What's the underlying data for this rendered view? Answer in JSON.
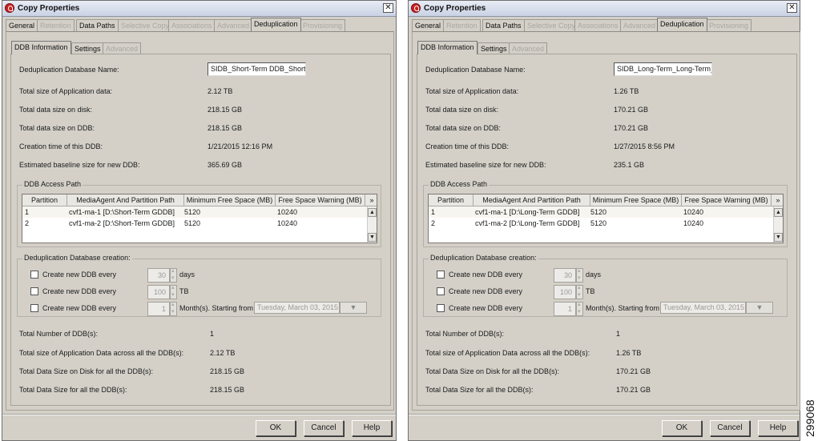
{
  "figure_number": "299068",
  "windows": [
    {
      "title": "Copy Properties",
      "close_glyph": "✕",
      "tabs": [
        {
          "label": "General",
          "state": "enabled"
        },
        {
          "label": "Retention",
          "state": "disabled"
        },
        {
          "label": "Data Paths",
          "state": "enabled"
        },
        {
          "label": "Selective Copy",
          "state": "disabled"
        },
        {
          "label": "Associations",
          "state": "disabled"
        },
        {
          "label": "Advanced",
          "state": "disabled"
        },
        {
          "label": "Deduplication",
          "state": "active"
        },
        {
          "label": "Provisioning",
          "state": "disabled"
        }
      ],
      "subtabs": [
        {
          "label": "DDB Information",
          "state": "active"
        },
        {
          "label": "Settings",
          "state": "enabled"
        },
        {
          "label": "Advanced",
          "state": "disabled"
        }
      ],
      "info": {
        "db_name_label": "Deduplication Database Name:",
        "db_name_value": "SIDB_Short-Term DDB_Short-T",
        "app_size_label": "Total size of Application data:",
        "app_size_value": "2.12 TB",
        "disk_size_label": "Total data size on disk:",
        "disk_size_value": "218.15 GB",
        "ddb_size_label": "Total data size on DDB:",
        "ddb_size_value": "218.15 GB",
        "creation_label": "Creation time of this DDB:",
        "creation_value": "1/21/2015 12:16 PM",
        "baseline_label": "Estimated baseline size for new DDB:",
        "baseline_value": "365.69 GB"
      },
      "access_path": {
        "title": "DDB Access Path",
        "columns": [
          "Partition",
          "MediaAgent And Partition Path",
          "Minimum Free Space (MB)",
          "Free Space Warning (MB)"
        ],
        "rows": [
          [
            "1",
            "cvf1-ma-1 [D:\\Short-Term GDDB]",
            "5120",
            "10240"
          ],
          [
            "2",
            "cvf1-ma-2 [D:\\Short-Term GDDB]",
            "5120",
            "10240"
          ]
        ]
      },
      "creation": {
        "title": "Deduplication Database creation:",
        "rows": [
          {
            "label": "Create new DDB every",
            "value": "30",
            "unit": "days"
          },
          {
            "label": "Create new DDB every",
            "value": "100",
            "unit": "TB"
          },
          {
            "label": "Create new DDB every",
            "value": "1",
            "unit": "Month(s). Starting from",
            "date": "Tuesday, March 03, 2015"
          }
        ]
      },
      "totals": {
        "num_label": "Total Number of DDB(s):",
        "num_value": "1",
        "app_label": "Total size of Application Data across all the DDB(s):",
        "app_value": "2.12 TB",
        "disk_label": "Total Data Size on Disk for all the DDB(s):",
        "disk_value": "218.15 GB",
        "ddb_label": "Total Data Size for all the DDB(s):",
        "ddb_value": "218.15 GB"
      },
      "buttons": {
        "ok": "OK",
        "cancel": "Cancel",
        "help": "Help"
      }
    },
    {
      "title": "Copy Properties",
      "close_glyph": "✕",
      "tabs": [
        {
          "label": "General",
          "state": "enabled"
        },
        {
          "label": "Retention",
          "state": "disabled"
        },
        {
          "label": "Data Paths",
          "state": "enabled"
        },
        {
          "label": "Selective Copy",
          "state": "disabled"
        },
        {
          "label": "Associations",
          "state": "disabled"
        },
        {
          "label": "Advanced",
          "state": "disabled"
        },
        {
          "label": "Deduplication",
          "state": "active"
        },
        {
          "label": "Provisioning",
          "state": "disabled"
        }
      ],
      "subtabs": [
        {
          "label": "DDB Information",
          "state": "active"
        },
        {
          "label": "Settings",
          "state": "enabled"
        },
        {
          "label": "Advanced",
          "state": "disabled"
        }
      ],
      "info": {
        "db_name_label": "Deduplication Database Name:",
        "db_name_value": "SIDB_Long-Term_Long-Term_I",
        "app_size_label": "Total size of Application data:",
        "app_size_value": "1.26 TB",
        "disk_size_label": "Total data size on disk:",
        "disk_size_value": "170.21 GB",
        "ddb_size_label": "Total data size on DDB:",
        "ddb_size_value": "170.21 GB",
        "creation_label": "Creation time of this DDB:",
        "creation_value": "1/27/2015 8:56 PM",
        "baseline_label": "Estimated baseline size for new DDB:",
        "baseline_value": "235.1 GB"
      },
      "access_path": {
        "title": "DDB Access Path",
        "columns": [
          "Partition",
          "MediaAgent And Partition Path",
          "Minimum Free Space (MB)",
          "Free Space Warning (MB)"
        ],
        "rows": [
          [
            "1",
            "cvf1-ma-1 [D:\\Long-Term GDDB]",
            "5120",
            "10240"
          ],
          [
            "2",
            "cvf1-ma-2 [D:\\Long-Term GDDB]",
            "5120",
            "10240"
          ]
        ]
      },
      "creation": {
        "title": "Deduplication Database creation:",
        "rows": [
          {
            "label": "Create new DDB every",
            "value": "30",
            "unit": "days"
          },
          {
            "label": "Create new DDB every",
            "value": "100",
            "unit": "TB"
          },
          {
            "label": "Create new DDB every",
            "value": "1",
            "unit": "Month(s). Starting from",
            "date": "Tuesday, March 03, 2015"
          }
        ]
      },
      "totals": {
        "num_label": "Total Number of DDB(s):",
        "num_value": "1",
        "app_label": "Total size of Application Data across all the DDB(s):",
        "app_value": "1.26 TB",
        "disk_label": "Total Data Size on Disk for all the DDB(s):",
        "disk_value": "170.21 GB",
        "ddb_label": "Total Data Size for all the DDB(s):",
        "ddb_value": "170.21 GB"
      },
      "buttons": {
        "ok": "OK",
        "cancel": "Cancel",
        "help": "Help"
      }
    }
  ]
}
